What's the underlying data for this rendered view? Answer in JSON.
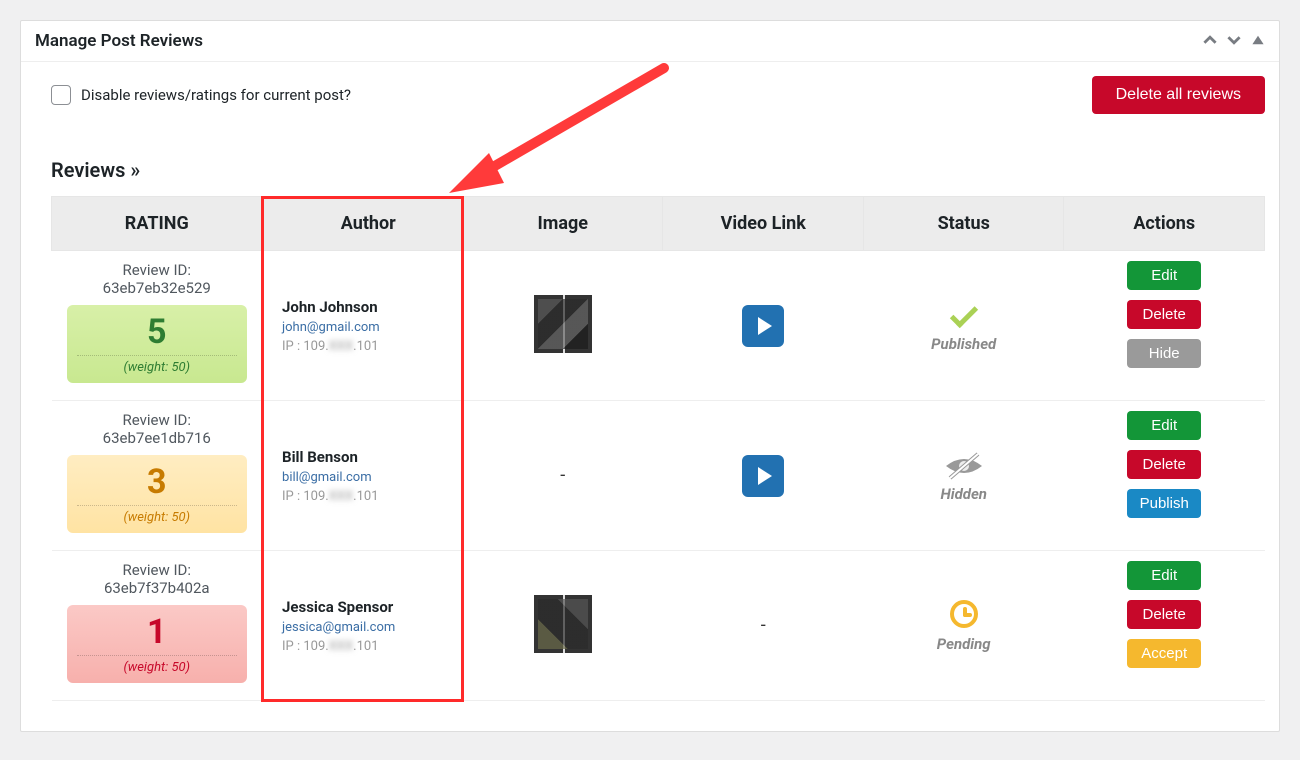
{
  "panel_title": "Manage Post Reviews",
  "disable_label": "Disable reviews/ratings for current post?",
  "delete_all_label": "Delete all reviews",
  "section_title": "Reviews »",
  "columns": {
    "rating": "RATING",
    "author": "Author",
    "image": "Image",
    "video": "Video Link",
    "status": "Status",
    "actions": "Actions"
  },
  "review_id_label": "Review ID:",
  "weight_prefix": "(weight: ",
  "weight_suffix": ")",
  "ip_prefix": "IP : ",
  "reviews": [
    {
      "id": "63eb7eb32e529",
      "rating": "5",
      "weight": "50",
      "author_name": "John Johnson",
      "author_email": "john@gmail.com",
      "ip_a": "109.",
      "ip_mask": "XXX",
      "ip_b": ".101",
      "has_image": true,
      "has_video": true,
      "status": "published",
      "status_label": "Published",
      "actions": [
        "edit",
        "delete",
        "hide"
      ]
    },
    {
      "id": "63eb7ee1db716",
      "rating": "3",
      "weight": "50",
      "author_name": "Bill Benson",
      "author_email": "bill@gmail.com",
      "ip_a": "109.",
      "ip_mask": "XXX",
      "ip_b": ".101",
      "has_image": false,
      "has_video": true,
      "status": "hidden",
      "status_label": "Hidden",
      "actions": [
        "edit",
        "delete",
        "publish"
      ]
    },
    {
      "id": "63eb7f37b402a",
      "rating": "1",
      "weight": "50",
      "author_name": "Jessica Spensor",
      "author_email": "jessica@gmail.com",
      "ip_a": "109.",
      "ip_mask": "XXX",
      "ip_b": ".101",
      "has_image": true,
      "has_video": false,
      "status": "pending",
      "status_label": "Pending",
      "actions": [
        "edit",
        "delete",
        "accept"
      ]
    }
  ],
  "action_labels": {
    "edit": "Edit",
    "delete": "Delete",
    "hide": "Hide",
    "publish": "Publish",
    "accept": "Accept"
  }
}
